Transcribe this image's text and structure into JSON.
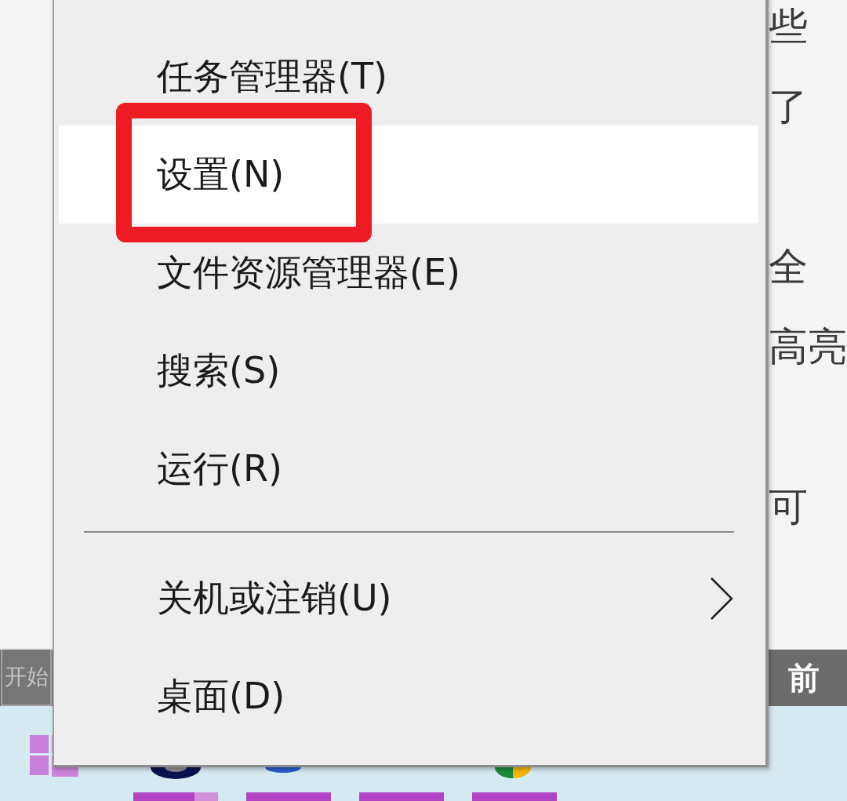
{
  "background_page": {
    "paragraphs": [
      [
        "些",
        "了"
      ],
      [
        "全",
        "高亮"
      ],
      [
        "可"
      ]
    ],
    "header_bar": {
      "text": "前"
    }
  },
  "start_tooltip": {
    "text": "开始"
  },
  "context_menu": {
    "items": [
      {
        "kind": "item",
        "label": "任务管理器(T)",
        "selected": false,
        "marked": false
      },
      {
        "kind": "item",
        "label": "设置(N)",
        "selected": true,
        "marked": true
      },
      {
        "kind": "item",
        "label": "文件资源管理器(E)",
        "selected": false,
        "marked": false
      },
      {
        "kind": "item",
        "label": "搜索(S)",
        "selected": false,
        "marked": false
      },
      {
        "kind": "item",
        "label": "运行(R)",
        "selected": false,
        "marked": false
      },
      {
        "kind": "separator"
      },
      {
        "kind": "submenu",
        "label": "关机或注销(U)",
        "selected": false,
        "marked": false
      },
      {
        "kind": "item",
        "label": "桌面(D)",
        "selected": false,
        "marked": false
      }
    ]
  }
}
